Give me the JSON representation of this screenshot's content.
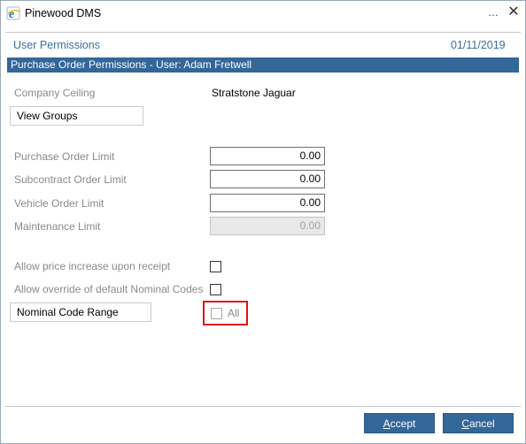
{
  "window": {
    "title": "Pinewood DMS",
    "minimize_glyph": "…",
    "close_glyph": "✕",
    "icon": "app-e-icon"
  },
  "header": {
    "title": "User Permissions",
    "date": "01/11/2019"
  },
  "section": {
    "title": "Purchase Order Permissions - User: Adam Fretwell"
  },
  "company": {
    "label": "Company Ceiling",
    "value": "Stratstone Jaguar"
  },
  "view_groups": {
    "label": "View Groups"
  },
  "limits": [
    {
      "label": "Purchase Order Limit",
      "value": "0.00",
      "disabled": false
    },
    {
      "label": "Subcontract Order Limit",
      "value": "0.00",
      "disabled": false
    },
    {
      "label": "Vehicle Order Limit",
      "value": "0.00",
      "disabled": false
    },
    {
      "label": "Maintenance Limit",
      "value": "0.00",
      "disabled": true
    }
  ],
  "options": {
    "price_increase_label": "Allow price increase upon receipt",
    "price_increase_checked": false,
    "override_nominal_label": "Allow override of default Nominal Codes",
    "override_nominal_checked": false
  },
  "nominal": {
    "label": "Nominal Code Range",
    "all_label": "All",
    "all_checked": false
  },
  "buttons": {
    "accept_pre": "",
    "accept_ul": "A",
    "accept_post": "ccept",
    "cancel_pre": "",
    "cancel_ul": "C",
    "cancel_post": "ancel"
  },
  "colors": {
    "accent": "#336699",
    "header_text": "#3a6ea5",
    "highlight": "#e01010"
  }
}
